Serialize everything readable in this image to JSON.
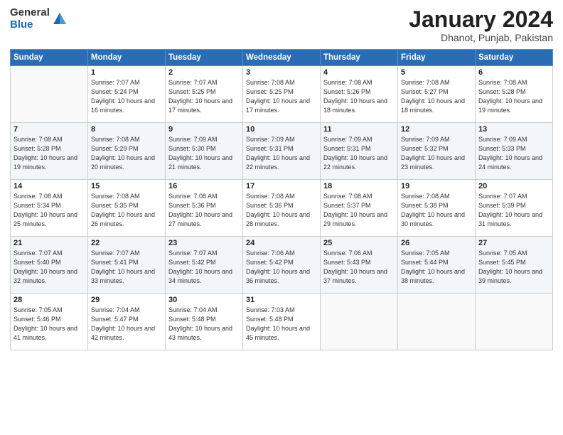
{
  "header": {
    "logo_general": "General",
    "logo_blue": "Blue",
    "month_title": "January 2024",
    "subtitle": "Dhanot, Punjab, Pakistan"
  },
  "days_of_week": [
    "Sunday",
    "Monday",
    "Tuesday",
    "Wednesday",
    "Thursday",
    "Friday",
    "Saturday"
  ],
  "weeks": [
    [
      {
        "day": "",
        "sunrise": "",
        "sunset": "",
        "daylight": ""
      },
      {
        "day": "1",
        "sunrise": "Sunrise: 7:07 AM",
        "sunset": "Sunset: 5:24 PM",
        "daylight": "Daylight: 10 hours and 16 minutes."
      },
      {
        "day": "2",
        "sunrise": "Sunrise: 7:07 AM",
        "sunset": "Sunset: 5:25 PM",
        "daylight": "Daylight: 10 hours and 17 minutes."
      },
      {
        "day": "3",
        "sunrise": "Sunrise: 7:08 AM",
        "sunset": "Sunset: 5:25 PM",
        "daylight": "Daylight: 10 hours and 17 minutes."
      },
      {
        "day": "4",
        "sunrise": "Sunrise: 7:08 AM",
        "sunset": "Sunset: 5:26 PM",
        "daylight": "Daylight: 10 hours and 18 minutes."
      },
      {
        "day": "5",
        "sunrise": "Sunrise: 7:08 AM",
        "sunset": "Sunset: 5:27 PM",
        "daylight": "Daylight: 10 hours and 18 minutes."
      },
      {
        "day": "6",
        "sunrise": "Sunrise: 7:08 AM",
        "sunset": "Sunset: 5:28 PM",
        "daylight": "Daylight: 10 hours and 19 minutes."
      }
    ],
    [
      {
        "day": "7",
        "sunrise": "Sunrise: 7:08 AM",
        "sunset": "Sunset: 5:28 PM",
        "daylight": "Daylight: 10 hours and 19 minutes."
      },
      {
        "day": "8",
        "sunrise": "Sunrise: 7:08 AM",
        "sunset": "Sunset: 5:29 PM",
        "daylight": "Daylight: 10 hours and 20 minutes."
      },
      {
        "day": "9",
        "sunrise": "Sunrise: 7:09 AM",
        "sunset": "Sunset: 5:30 PM",
        "daylight": "Daylight: 10 hours and 21 minutes."
      },
      {
        "day": "10",
        "sunrise": "Sunrise: 7:09 AM",
        "sunset": "Sunset: 5:31 PM",
        "daylight": "Daylight: 10 hours and 22 minutes."
      },
      {
        "day": "11",
        "sunrise": "Sunrise: 7:09 AM",
        "sunset": "Sunset: 5:31 PM",
        "daylight": "Daylight: 10 hours and 22 minutes."
      },
      {
        "day": "12",
        "sunrise": "Sunrise: 7:09 AM",
        "sunset": "Sunset: 5:32 PM",
        "daylight": "Daylight: 10 hours and 23 minutes."
      },
      {
        "day": "13",
        "sunrise": "Sunrise: 7:09 AM",
        "sunset": "Sunset: 5:33 PM",
        "daylight": "Daylight: 10 hours and 24 minutes."
      }
    ],
    [
      {
        "day": "14",
        "sunrise": "Sunrise: 7:08 AM",
        "sunset": "Sunset: 5:34 PM",
        "daylight": "Daylight: 10 hours and 25 minutes."
      },
      {
        "day": "15",
        "sunrise": "Sunrise: 7:08 AM",
        "sunset": "Sunset: 5:35 PM",
        "daylight": "Daylight: 10 hours and 26 minutes."
      },
      {
        "day": "16",
        "sunrise": "Sunrise: 7:08 AM",
        "sunset": "Sunset: 5:36 PM",
        "daylight": "Daylight: 10 hours and 27 minutes."
      },
      {
        "day": "17",
        "sunrise": "Sunrise: 7:08 AM",
        "sunset": "Sunset: 5:36 PM",
        "daylight": "Daylight: 10 hours and 28 minutes."
      },
      {
        "day": "18",
        "sunrise": "Sunrise: 7:08 AM",
        "sunset": "Sunset: 5:37 PM",
        "daylight": "Daylight: 10 hours and 29 minutes."
      },
      {
        "day": "19",
        "sunrise": "Sunrise: 7:08 AM",
        "sunset": "Sunset: 5:38 PM",
        "daylight": "Daylight: 10 hours and 30 minutes."
      },
      {
        "day": "20",
        "sunrise": "Sunrise: 7:07 AM",
        "sunset": "Sunset: 5:39 PM",
        "daylight": "Daylight: 10 hours and 31 minutes."
      }
    ],
    [
      {
        "day": "21",
        "sunrise": "Sunrise: 7:07 AM",
        "sunset": "Sunset: 5:40 PM",
        "daylight": "Daylight: 10 hours and 32 minutes."
      },
      {
        "day": "22",
        "sunrise": "Sunrise: 7:07 AM",
        "sunset": "Sunset: 5:41 PM",
        "daylight": "Daylight: 10 hours and 33 minutes."
      },
      {
        "day": "23",
        "sunrise": "Sunrise: 7:07 AM",
        "sunset": "Sunset: 5:42 PM",
        "daylight": "Daylight: 10 hours and 34 minutes."
      },
      {
        "day": "24",
        "sunrise": "Sunrise: 7:06 AM",
        "sunset": "Sunset: 5:42 PM",
        "daylight": "Daylight: 10 hours and 36 minutes."
      },
      {
        "day": "25",
        "sunrise": "Sunrise: 7:06 AM",
        "sunset": "Sunset: 5:43 PM",
        "daylight": "Daylight: 10 hours and 37 minutes."
      },
      {
        "day": "26",
        "sunrise": "Sunrise: 7:05 AM",
        "sunset": "Sunset: 5:44 PM",
        "daylight": "Daylight: 10 hours and 38 minutes."
      },
      {
        "day": "27",
        "sunrise": "Sunrise: 7:05 AM",
        "sunset": "Sunset: 5:45 PM",
        "daylight": "Daylight: 10 hours and 39 minutes."
      }
    ],
    [
      {
        "day": "28",
        "sunrise": "Sunrise: 7:05 AM",
        "sunset": "Sunset: 5:46 PM",
        "daylight": "Daylight: 10 hours and 41 minutes."
      },
      {
        "day": "29",
        "sunrise": "Sunrise: 7:04 AM",
        "sunset": "Sunset: 5:47 PM",
        "daylight": "Daylight: 10 hours and 42 minutes."
      },
      {
        "day": "30",
        "sunrise": "Sunrise: 7:04 AM",
        "sunset": "Sunset: 5:48 PM",
        "daylight": "Daylight: 10 hours and 43 minutes."
      },
      {
        "day": "31",
        "sunrise": "Sunrise: 7:03 AM",
        "sunset": "Sunset: 5:48 PM",
        "daylight": "Daylight: 10 hours and 45 minutes."
      },
      {
        "day": "",
        "sunrise": "",
        "sunset": "",
        "daylight": ""
      },
      {
        "day": "",
        "sunrise": "",
        "sunset": "",
        "daylight": ""
      },
      {
        "day": "",
        "sunrise": "",
        "sunset": "",
        "daylight": ""
      }
    ]
  ]
}
